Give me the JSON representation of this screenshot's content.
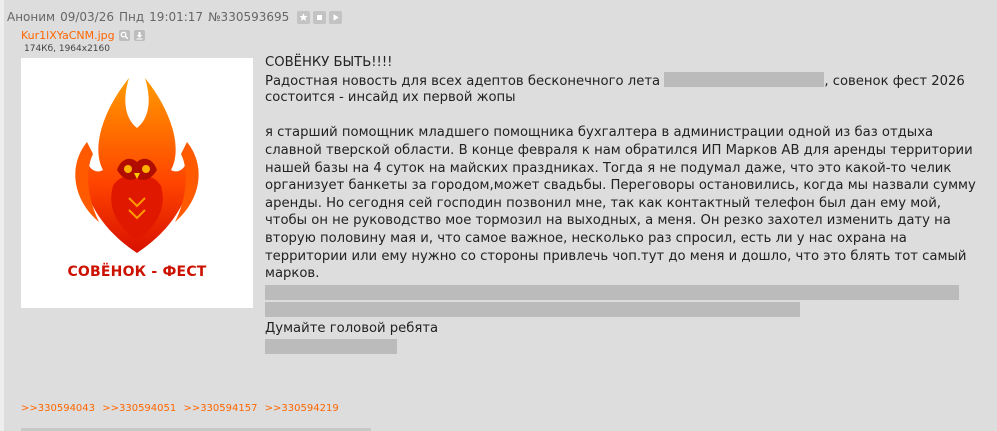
{
  "post": {
    "author": "Аноним",
    "date": "09/03/26",
    "weekday": "Пнд",
    "time": "19:01:17",
    "number": "№330593695",
    "header_icons": [
      "star-icon",
      "stop-icon",
      "play-icon"
    ]
  },
  "file": {
    "name": "Kur1lXYaCNM.jpg",
    "info": "174Кб, 1964x2160",
    "icons": [
      "search-icon",
      "download-icon"
    ],
    "image_caption": "СОВЁНОК - ФЕСТ"
  },
  "message": {
    "title": "СОВЁНКУ БЫТЬ!!!!",
    "line1_before": "Радостная новость для всех адептов бесконечного лета",
    "line1_after": ", совенок фест 2026",
    "line2": "состоится - инсайд их первой жопы",
    "para": [
      "я старший помощник младшего помощника бухгалтера в администрации одной из баз отдыха",
      "славной тверской области. В конце февраля к нам обратился ИП Марков АВ для аренды территории",
      "нашей базы на 4 суток на майских праздниках. Тогда я не подумал даже, что это какой-то челик",
      "организует банкеты за городом,может свадьбы. Переговоры остановились, когда мы назвали сумму",
      "аренды. Но сегодня сей господин позвонил мне, так как контактный телефон был дан ему мой,",
      "чтобы он не руководство мое тормозил на выходных, а меня. Он резко захотел изменить дату на",
      "вторую половину мая и, что самое важное, несколько раз спросил, есть ли у нас охрана на",
      "территории или ему нужно со стороны привлечь чоп.тут до меня и дошло, что это блять тот самый",
      "марков."
    ],
    "closing": "Думайте головой ребята"
  },
  "replies": [
    ">>330594043",
    ">>330594051",
    ">>330594157",
    ">>330594219"
  ],
  "colors": {
    "background": "#eeeeee",
    "post_bg": "#dddddd",
    "link": "#ff6600",
    "redaction": "#bbbbbb",
    "logo_red": "#cc1100",
    "logo_orange": "#ff6a00"
  }
}
